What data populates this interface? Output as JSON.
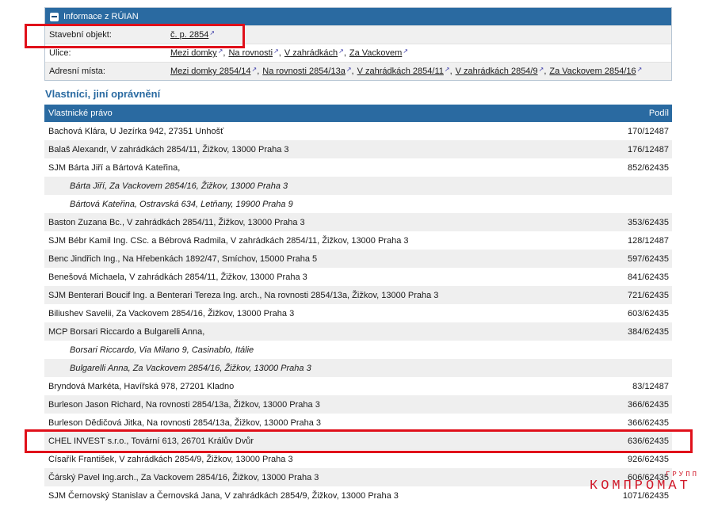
{
  "ruian": {
    "title": "Informace z RÚIAN",
    "rows": [
      {
        "label": "Stavební objekt:",
        "values": [
          "č. p. 2854"
        ]
      },
      {
        "label": "Ulice:",
        "values": [
          "Mezi domky",
          "Na rovnosti",
          "V zahrádkách",
          "Za Vackovem"
        ]
      },
      {
        "label": "Adresní místa:",
        "values": [
          "Mezi domky 2854/14",
          "Na rovnosti 2854/13a",
          "V zahrádkách 2854/11",
          "V zahrádkách 2854/9",
          "Za Vackovem 2854/16"
        ]
      }
    ]
  },
  "owners": {
    "section_title": "Vlastníci, jiní oprávnění",
    "col_right": "Vlastnické právo",
    "col_share": "Podíl",
    "rows": [
      {
        "name": "Bachová Klára, U Jezírka 942, 27351 Unhošť",
        "share": "170/12487",
        "sub": false
      },
      {
        "name": "Balaš Alexandr, V zahrádkách 2854/11, Žižkov, 13000 Praha 3",
        "share": "176/12487",
        "sub": false
      },
      {
        "name": "SJM Bárta Jiří a Bártová Kateřina,",
        "share": "852/62435",
        "sub": false
      },
      {
        "name": "Bárta Jiří, Za Vackovem 2854/16, Žižkov, 13000 Praha 3",
        "share": "",
        "sub": true
      },
      {
        "name": "Bártová Kateřina, Ostravská 634, Letňany, 19900 Praha 9",
        "share": "",
        "sub": true
      },
      {
        "name": "Baston Zuzana Bc., V zahrádkách 2854/11, Žižkov, 13000 Praha 3",
        "share": "353/62435",
        "sub": false
      },
      {
        "name": "SJM Bébr Kamil Ing. CSc. a Bébrová Radmila, V zahrádkách 2854/11, Žižkov, 13000 Praha 3",
        "share": "128/12487",
        "sub": false
      },
      {
        "name": "Benc Jindřich Ing., Na Hřebenkách 1892/47, Smíchov, 15000 Praha 5",
        "share": "597/62435",
        "sub": false
      },
      {
        "name": "Benešová Michaela, V zahrádkách 2854/11, Žižkov, 13000 Praha 3",
        "share": "841/62435",
        "sub": false
      },
      {
        "name": "SJM Benterari Boucif Ing. a Benterari Tereza Ing. arch., Na rovnosti 2854/13a, Žižkov, 13000 Praha 3",
        "share": "721/62435",
        "sub": false
      },
      {
        "name": "Biliushev Savelii, Za Vackovem 2854/16, Žižkov, 13000 Praha 3",
        "share": "603/62435",
        "sub": false
      },
      {
        "name": "MCP Borsari Riccardo a Bulgarelli Anna,",
        "share": "384/62435",
        "sub": false
      },
      {
        "name": "Borsari Riccardo, Via Milano 9, Casinablo, Itálie",
        "share": "",
        "sub": true
      },
      {
        "name": "Bulgarelli Anna, Za Vackovem 2854/16, Žižkov, 13000 Praha 3",
        "share": "",
        "sub": true
      },
      {
        "name": "Bryndová Markéta, Havířská 978, 27201 Kladno",
        "share": "83/12487",
        "sub": false
      },
      {
        "name": "Burleson Jason Richard, Na rovnosti 2854/13a, Žižkov, 13000 Praha 3",
        "share": "366/62435",
        "sub": false
      },
      {
        "name": "Burleson Dědičová Jitka, Na rovnosti 2854/13a, Žižkov, 13000 Praha 3",
        "share": "366/62435",
        "sub": false
      },
      {
        "name": "CHEL INVEST s.r.o., Tovární 613, 26701 Králův Dvůr",
        "share": "636/62435",
        "sub": false
      },
      {
        "name": "Císařík František, V zahrádkách 2854/9, Žižkov, 13000 Praha 3",
        "share": "926/62435",
        "sub": false
      },
      {
        "name": "Čárský Pavel Ing.arch., Za Vackovem 2854/16, Žižkov, 13000 Praha 3",
        "share": "606/62435",
        "sub": false
      },
      {
        "name": "SJM Černovský Stanislav a Černovská Jana, V zahrádkách 2854/9, Žižkov, 13000 Praha 3",
        "share": "1071/62435",
        "sub": false
      }
    ]
  },
  "watermark": {
    "small": "ГРУПП",
    "big": "КОМПРОМАТ"
  },
  "colors": {
    "header_blue": "#2a6aa1",
    "highlight_red": "#e0101a",
    "watermark_red": "#d11a2a"
  }
}
